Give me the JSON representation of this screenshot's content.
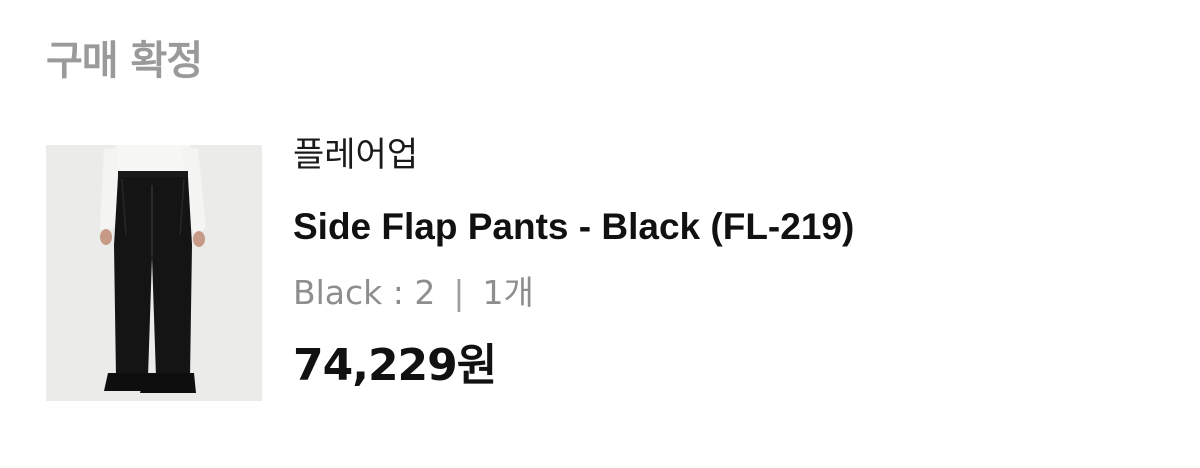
{
  "order": {
    "status": "구매 확정"
  },
  "product": {
    "brand": "플레어업",
    "name": "Side Flap Pants - Black (FL-219)",
    "option": "Black : 2",
    "separator": "|",
    "quantity": "1개",
    "price": "74,229원"
  },
  "colors": {
    "status_text": "#9a9a9a",
    "option_text": "#8e8e8e",
    "thumbnail_bg": "#e9e9e7"
  }
}
